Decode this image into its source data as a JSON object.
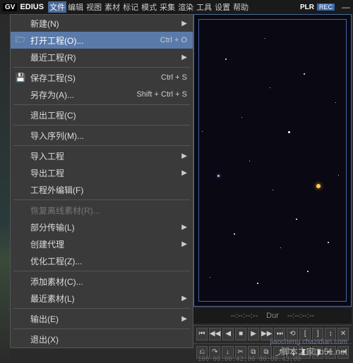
{
  "title": {
    "logo": "GV",
    "app": "EDIUS"
  },
  "menubar": [
    "文件",
    "编辑",
    "视图",
    "素材",
    "标记",
    "模式",
    "采集",
    "渲染",
    "工具",
    "设置",
    "帮助"
  ],
  "title_right": {
    "plr": "PLR",
    "rec": "REC",
    "min": "—"
  },
  "dropdown": {
    "new": "新建(N)",
    "open": "打开工程(O)...",
    "open_sc": "Ctrl + O",
    "recent": "最近工程(R)",
    "save": "保存工程(S)",
    "save_sc": "Ctrl + S",
    "saveas": "另存为(A)...",
    "saveas_sc": "Shift + Ctrl + S",
    "closep": "退出工程(C)",
    "import_seq": "导入序列(M)...",
    "import_proj": "导入工程",
    "export_proj": "导出工程",
    "ext_edit": "工程外编辑(F)",
    "restore": "恢复离线素材(R)...",
    "partial": "部分传输(L)",
    "proxy": "创建代理",
    "optimize": "优化工程(Z)...",
    "add_clip": "添加素材(C)...",
    "recent_clip": "最近素材(L)",
    "output": "输出(E)",
    "exit": "退出(X)"
  },
  "timecode": {
    "left": "--:--:--:--",
    "dur": "Dur",
    "right": "--:--:--:--"
  },
  "transport": [
    "⏮",
    "◀◀",
    "◀",
    "■",
    "▶",
    "▶▶",
    "⏭",
    "⟲",
    "[",
    "]",
    "↕",
    "✕"
  ],
  "editbar": [
    "⎌",
    "↷",
    "↓",
    "✂",
    "⧉",
    "⧉",
    "⤴",
    "⤵",
    "◧",
    "◨",
    "⇤",
    "⇥"
  ],
  "watermark": "脚本之家 jb51.net",
  "watermark2": "jiaocheng.chazidian.com",
  "tc_bottom": "100 00:00:42;00        00:00:43;00"
}
